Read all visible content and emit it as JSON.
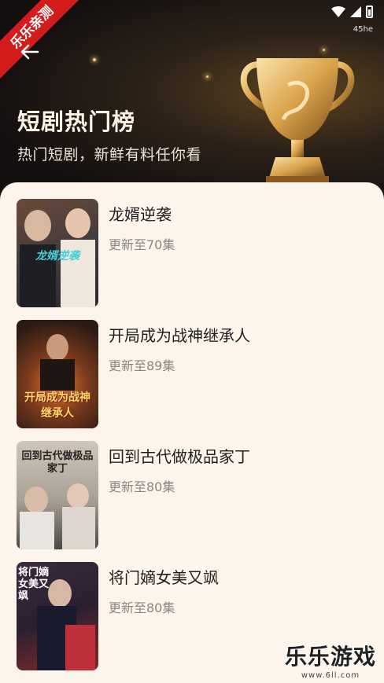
{
  "status_bar": {
    "carrier": "45he"
  },
  "watermark_ribbon": "乐乐亲测",
  "header": {
    "title": "短剧热门榜",
    "subtitle": "热门短剧，新鲜有料任你看"
  },
  "dramas": [
    {
      "title": "龙婿逆袭",
      "status": "更新至70集",
      "poster_text": "龙婿逆袭",
      "poster_colors": [
        "#6b4a3a",
        "#2a2a2e"
      ]
    },
    {
      "title": "开局成为战神继承人",
      "status": "更新至89集",
      "poster_text": "开局成为战神继承人",
      "poster_colors": [
        "#7a3a1c",
        "#2b1a14"
      ]
    },
    {
      "title": "回到古代做极品家丁",
      "status": "更新至80集",
      "poster_text": "回到古代做极品家丁",
      "poster_colors": [
        "#b8b0a4",
        "#5a5450"
      ]
    },
    {
      "title": "将门嫡女美又飒",
      "status": "更新至80集",
      "poster_text": "将门嫡女美又飒",
      "poster_colors": [
        "#3a2a3e",
        "#8a2a2a"
      ]
    }
  ],
  "footer_watermark": {
    "name": "乐乐游戏",
    "url": "www.6ll.com"
  },
  "colors": {
    "accent_red": "#d41c1c",
    "list_bg": "#fdf5ec",
    "gold": "#d9a24a"
  },
  "icons": [
    "back-arrow-icon",
    "wifi-icon",
    "signal-icon",
    "battery-icon",
    "trophy-icon"
  ]
}
